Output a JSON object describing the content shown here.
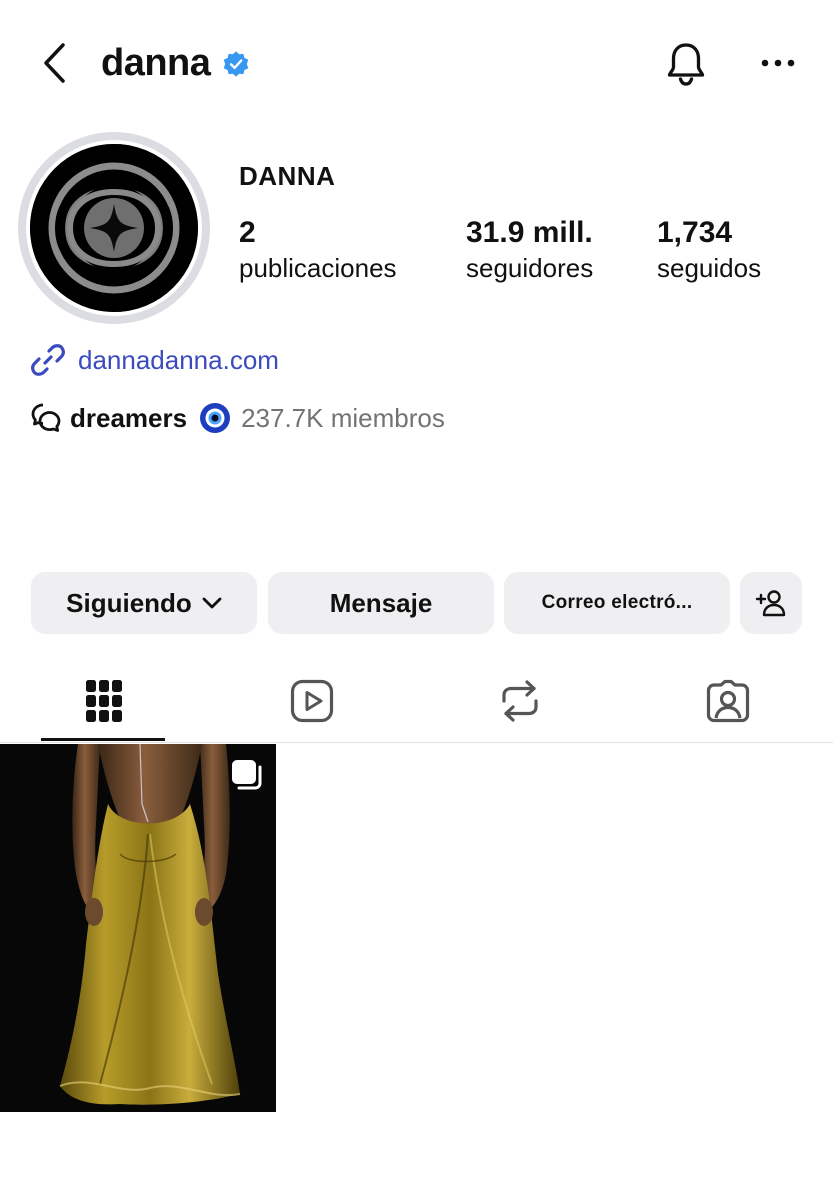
{
  "header": {
    "username": "danna",
    "icons": {
      "back": "chevron-left-icon",
      "verified": "verified-badge-icon",
      "notifications": "bell-icon",
      "more": "more-horizontal-icon"
    }
  },
  "profile": {
    "display_name": "DANNA",
    "stats": [
      {
        "value": "2",
        "label": "publicaciones"
      },
      {
        "value": "31.9 mill.",
        "label": "seguidores"
      },
      {
        "value": "1,734",
        "label": "seguidos"
      }
    ],
    "link": {
      "text": "dannadanna.com",
      "icon": "link-icon"
    },
    "channel": {
      "name": "dreamers",
      "emoji": "nazar-amulet-emoji",
      "members": "237.7K miembros",
      "icon": "broadcast-channel-icon"
    }
  },
  "actions": {
    "following_label": "Siguiendo",
    "message_label": "Mensaje",
    "email_label": "Correo electró...",
    "add_user_icon": "add-user-icon"
  },
  "tabs": [
    {
      "name": "posts",
      "icon": "grid-icon",
      "active": true
    },
    {
      "name": "reels",
      "icon": "reels-icon",
      "active": false
    },
    {
      "name": "reposts",
      "icon": "repost-icon",
      "active": false
    },
    {
      "name": "tagged",
      "icon": "tagged-user-icon",
      "active": false
    }
  ],
  "posts": [
    {
      "description_icon": "carousel-icon",
      "type": "carousel"
    }
  ],
  "colors": {
    "link": "#3b4bbd",
    "verified": "#3897f0",
    "button_bg": "#efeff2",
    "muted_text": "#737373"
  }
}
